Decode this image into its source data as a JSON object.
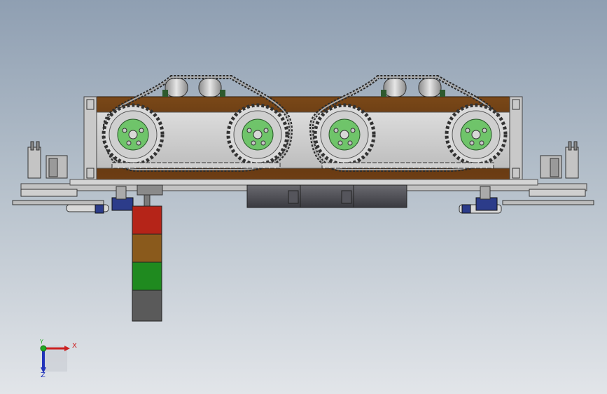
{
  "viewport": {
    "background_top": "#8f9fb2",
    "background_bottom": "#e2e5e9"
  },
  "model": {
    "frame_color": "#6b3c14",
    "sprocket_hub_color": "#6fc46a",
    "stack_light_colors": [
      "#b52418",
      "#8a5a1c",
      "#1f8a1f",
      "#5a5a5a"
    ]
  },
  "triad": {
    "x_label": "X",
    "y_label": "Y",
    "z_label": "Z",
    "x_color": "#cc2222",
    "y_color": "#22aa22",
    "z_color": "#2233bb"
  }
}
